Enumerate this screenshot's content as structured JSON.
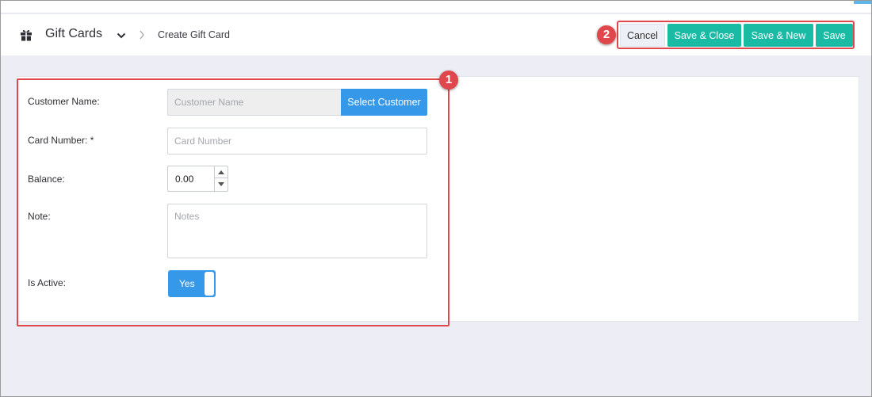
{
  "header": {
    "title": "Gift Cards",
    "breadcrumb": "Create Gift Card",
    "icon": "gift-icon"
  },
  "toolbar": {
    "cancel_label": "Cancel",
    "save_close_label": "Save & Close",
    "save_new_label": "Save & New",
    "save_label": "Save"
  },
  "annotations": {
    "badge_1": "1",
    "badge_2": "2"
  },
  "form": {
    "customer_name_label": "Customer Name:",
    "customer_name_placeholder": "Customer Name",
    "select_customer_label": "Select Customer",
    "card_number_label": "Card Number: *",
    "card_number_placeholder": "Card Number",
    "balance_label": "Balance:",
    "balance_value": "0.00",
    "note_label": "Note:",
    "note_placeholder": "Notes",
    "is_active_label": "Is Active:",
    "is_active_value": "Yes"
  },
  "colors": {
    "accent_blue": "#3598e9",
    "teal": "#19bba5",
    "highlight_red": "#e0474c"
  }
}
